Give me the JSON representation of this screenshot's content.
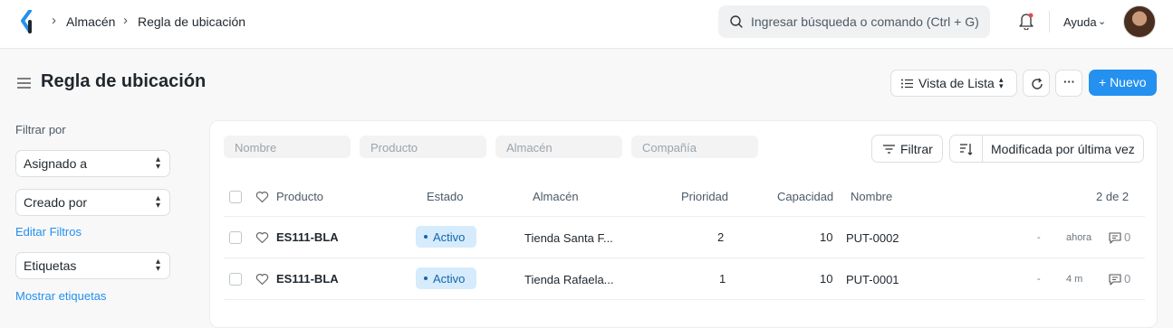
{
  "navbar": {
    "breadcrumbs": [
      "Almacén",
      "Regla de ubicación"
    ],
    "separator": "›",
    "search_placeholder": "Ingresar búsqueda o comando (Ctrl + G)",
    "help_label": "Ayuda"
  },
  "page": {
    "title": "Regla de ubicación",
    "list_view_label": "Vista de Lista",
    "more_label": "···",
    "new_label": "+ Nuevo"
  },
  "sidebar": {
    "filter_by": "Filtrar por",
    "assigned_to": "Asignado a",
    "created_by": "Creado por",
    "edit_filters": "Editar Filtros",
    "tags": "Etiquetas",
    "show_tags": "Mostrar etiquetas"
  },
  "filters": {
    "name_placeholder": "Nombre",
    "product_placeholder": "Producto",
    "warehouse_placeholder": "Almacén",
    "company_placeholder": "Compañía",
    "filter_label": "Filtrar",
    "sort_label": "Modificada por última vez"
  },
  "table": {
    "headers": {
      "product": "Producto",
      "status": "Estado",
      "warehouse": "Almacén",
      "priority": "Prioridad",
      "capacity": "Capacidad",
      "name": "Nombre",
      "count": "2 de 2"
    },
    "rows": [
      {
        "product": "ES111-BLA",
        "status": "Activo",
        "warehouse": "Tienda Santa F...",
        "priority": "2",
        "capacity": "10",
        "name": "PUT-0002",
        "dash": "-",
        "time": "ahora",
        "comments": "0"
      },
      {
        "product": "ES111-BLA",
        "status": "Activo",
        "warehouse": "Tienda Rafaela...",
        "priority": "1",
        "capacity": "10",
        "name": "PUT-0001",
        "dash": "-",
        "time": "4 m",
        "comments": "0"
      }
    ]
  },
  "colors": {
    "primary": "#2490ef",
    "badge_bg": "#d6ebfb",
    "badge_text": "#1366ae"
  }
}
